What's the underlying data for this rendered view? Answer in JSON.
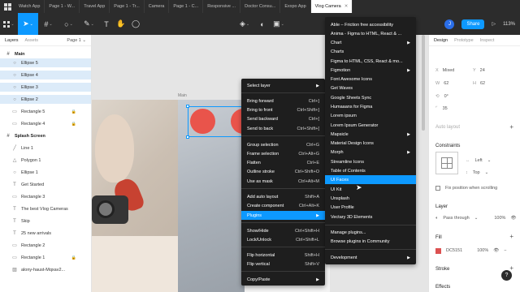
{
  "tabs": [
    {
      "label": "Watch App",
      "active": false
    },
    {
      "label": "Page 1 - W...",
      "active": false
    },
    {
      "label": "Travel App",
      "active": false
    },
    {
      "label": "Page 1 - Tr...",
      "active": false
    },
    {
      "label": "Camera",
      "active": false
    },
    {
      "label": "Page 1 - C...",
      "active": false
    },
    {
      "label": "Responsive ...",
      "active": false
    },
    {
      "label": "Doctor Consu...",
      "active": false
    },
    {
      "label": "Exxpo App",
      "active": false
    },
    {
      "label": "Vlog Camera",
      "active": true
    }
  ],
  "tab_home_icon": "figma-home-icon",
  "toolbar": {
    "avatar_letter": "J",
    "share_label": "Share",
    "play_icon": "▷",
    "zoom": "113%"
  },
  "left_panel": {
    "tabs": [
      "Layers",
      "Assets"
    ],
    "page_label": "Page 1 ⌄",
    "layers": [
      {
        "label": "Main",
        "type": "frame",
        "highlight": false,
        "locked": false
      },
      {
        "label": "Ellipse 5",
        "type": "ellipse",
        "highlight": true,
        "locked": false
      },
      {
        "label": "Ellipse 4",
        "type": "ellipse",
        "highlight": true,
        "locked": false
      },
      {
        "label": "Ellipse 3",
        "type": "ellipse",
        "highlight": true,
        "locked": false
      },
      {
        "label": "Ellipse 2",
        "type": "ellipse",
        "highlight": true,
        "locked": false
      },
      {
        "label": "Rectangle 5",
        "type": "rect",
        "highlight": false,
        "locked": true
      },
      {
        "label": "Rectangle 4",
        "type": "rect",
        "highlight": false,
        "locked": true
      },
      {
        "label": "Splash Screen",
        "type": "frame",
        "highlight": false,
        "locked": false
      },
      {
        "label": "Line 1",
        "type": "line",
        "highlight": false,
        "locked": false
      },
      {
        "label": "Polygon 1",
        "type": "polygon",
        "highlight": false,
        "locked": false
      },
      {
        "label": "Ellipse 1",
        "type": "ellipse",
        "highlight": false,
        "locked": false
      },
      {
        "label": "Get Started",
        "type": "text",
        "highlight": false,
        "locked": false
      },
      {
        "label": "Rectangle 3",
        "type": "rect",
        "highlight": false,
        "locked": false
      },
      {
        "label": "The best Vlog Cameras",
        "type": "text",
        "highlight": false,
        "locked": false
      },
      {
        "label": "Skip",
        "type": "text",
        "highlight": false,
        "locked": false
      },
      {
        "label": "25 new arrivals",
        "type": "text",
        "highlight": false,
        "locked": false
      },
      {
        "label": "Rectangle 2",
        "type": "rect",
        "highlight": false,
        "locked": false
      },
      {
        "label": "Rectangle 1",
        "type": "rect",
        "highlight": false,
        "locked": true
      },
      {
        "label": "alony-haust-Mqxav2...",
        "type": "image",
        "highlight": false,
        "locked": false
      }
    ]
  },
  "canvas": {
    "frame_label": "Main",
    "ellipse_color": "#E9544B"
  },
  "context_menu": {
    "items": [
      {
        "label": "Select layer",
        "shortcut": "",
        "submenu": true
      },
      {
        "label": "Bring forward",
        "shortcut": "Ctrl+]"
      },
      {
        "label": "Bring to front",
        "shortcut": "Ctrl+Shift+]"
      },
      {
        "label": "Send backward",
        "shortcut": "Ctrl+["
      },
      {
        "label": "Send to back",
        "shortcut": "Ctrl+Shift+["
      },
      {
        "label": "Group selection",
        "shortcut": "Ctrl+G"
      },
      {
        "label": "Frame selection",
        "shortcut": "Ctrl+Alt+G"
      },
      {
        "label": "Flatten",
        "shortcut": "Ctrl+E"
      },
      {
        "label": "Outline stroke",
        "shortcut": "Ctrl+Shift+O"
      },
      {
        "label": "Use as mask",
        "shortcut": "Ctrl+Alt+M"
      },
      {
        "label": "Add auto layout",
        "shortcut": "Shift+A"
      },
      {
        "label": "Create component",
        "shortcut": "Ctrl+Alt+K"
      },
      {
        "label": "Plugins",
        "shortcut": "",
        "submenu": true,
        "highlight": true
      },
      {
        "label": "Show/Hide",
        "shortcut": "Ctrl+Shift+H"
      },
      {
        "label": "Lock/Unlock",
        "shortcut": "Ctrl+Shift+L"
      },
      {
        "label": "Flip horizontal",
        "shortcut": "Shift+H"
      },
      {
        "label": "Flip vertical",
        "shortcut": "Shift+V"
      },
      {
        "label": "Copy/Paste",
        "shortcut": "",
        "submenu": true
      }
    ]
  },
  "plugins_menu": {
    "items": [
      {
        "label": "Able – Friction free accessibility",
        "submenu": false
      },
      {
        "label": "Anima - Figma to HTML, React & ...",
        "submenu": false
      },
      {
        "label": "Chart",
        "submenu": true
      },
      {
        "label": "Charts",
        "submenu": false
      },
      {
        "label": "Figma to HTML, CSS, React & mo...",
        "submenu": false
      },
      {
        "label": "Figmotion",
        "submenu": true
      },
      {
        "label": "Font Awesome Icons",
        "submenu": false
      },
      {
        "label": "Get Waves",
        "submenu": false
      },
      {
        "label": "Google Sheets Sync",
        "submenu": false
      },
      {
        "label": "Humaaans for Figma",
        "submenu": false
      },
      {
        "label": "Lorem ipsum",
        "submenu": false
      },
      {
        "label": "Lorem Ipsum Generator",
        "submenu": false
      },
      {
        "label": "Mapsicle",
        "submenu": true
      },
      {
        "label": "Material Design Icons",
        "submenu": false
      },
      {
        "label": "Morph",
        "submenu": true
      },
      {
        "label": "Streamline Icons",
        "submenu": false
      },
      {
        "label": "Table of Contents",
        "submenu": false
      },
      {
        "label": "UI Faces",
        "submenu": false,
        "highlight": true
      },
      {
        "label": "UI Kit",
        "submenu": false
      },
      {
        "label": "Unsplash",
        "submenu": false
      },
      {
        "label": "User Profile",
        "submenu": false
      },
      {
        "label": "Vectary 3D Elements",
        "submenu": false
      },
      {
        "label": "Manage plugins...",
        "submenu": false
      },
      {
        "label": "Browse plugins in Community",
        "submenu": false
      },
      {
        "label": "Development",
        "submenu": true
      }
    ]
  },
  "right_panel": {
    "tabs": [
      "Design",
      "Prototype",
      "Inspect"
    ],
    "x_label": "X",
    "x_value": "Mixed",
    "y_label": "Y",
    "y_value": "24",
    "w_label": "W",
    "w_value": "62",
    "h_label": "H",
    "h_value": "62",
    "rotation": "0°",
    "radius": "35",
    "auto_layout_label": "Auto layout",
    "constraints_label": "Constraints",
    "constraint_h": "Left",
    "constraint_v": "Top",
    "fix_position_label": "Fix position when scrolling",
    "layer_label": "Layer",
    "blend_mode": "Pass through",
    "layer_opacity": "100%",
    "fill_label": "Fill",
    "fill_hex": "DC5151",
    "fill_opacity": "100%",
    "fill_color": "#DC5151",
    "stroke_label": "Stroke",
    "effects_label": "Effects"
  },
  "help_label": "?"
}
